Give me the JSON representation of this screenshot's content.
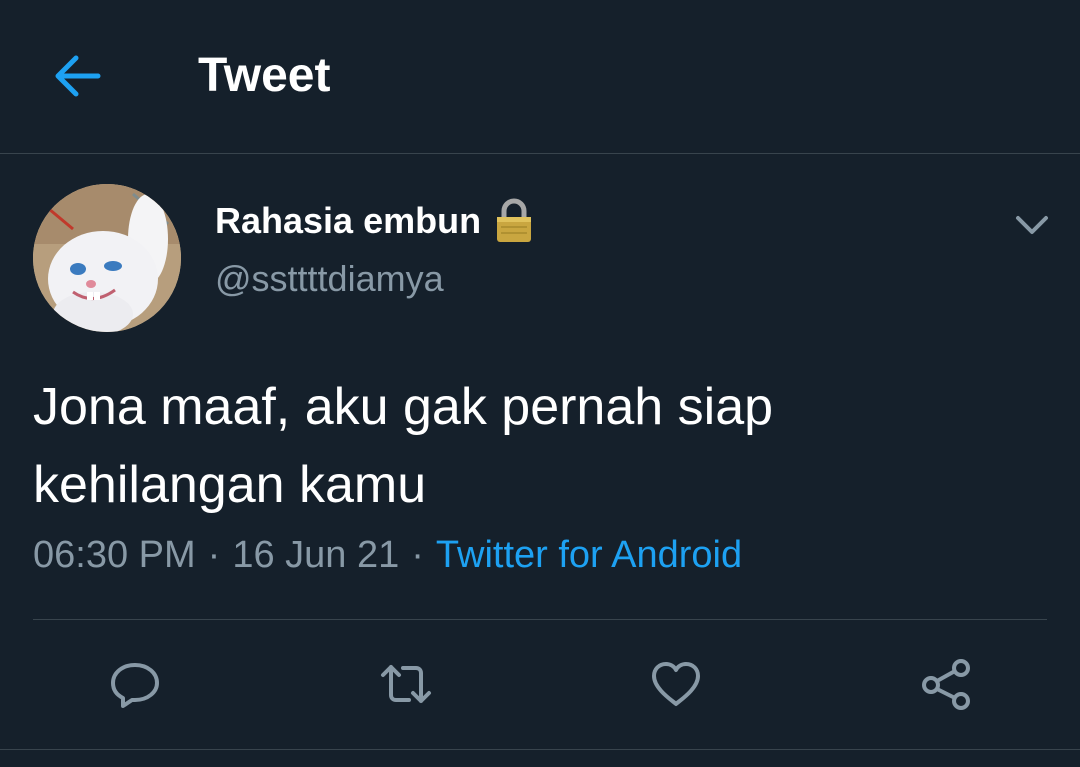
{
  "header": {
    "title": "Tweet",
    "back_icon": "arrow-left-icon"
  },
  "tweet": {
    "author": {
      "name": "Rahasia embun",
      "handle": "@ssttttdiamya",
      "protected_icon": "lock-icon",
      "avatar": "avatar-image"
    },
    "text_lines": [
      "Jona maaf, aku gak pernah siap",
      "kehilangan kamu"
    ],
    "time": "06:30 PM",
    "date": "16 Jun 21",
    "separator": "·",
    "source": "Twitter for Android",
    "more_icon": "chevron-down-icon"
  },
  "actions": [
    {
      "name": "reply",
      "icon": "reply-icon"
    },
    {
      "name": "retweet",
      "icon": "retweet-icon"
    },
    {
      "name": "like",
      "icon": "heart-icon"
    },
    {
      "name": "share",
      "icon": "share-icon"
    }
  ],
  "colors": {
    "background": "#15202b",
    "accent": "#1da1f2",
    "secondary_text": "#8899a6",
    "divider": "#38444d"
  }
}
